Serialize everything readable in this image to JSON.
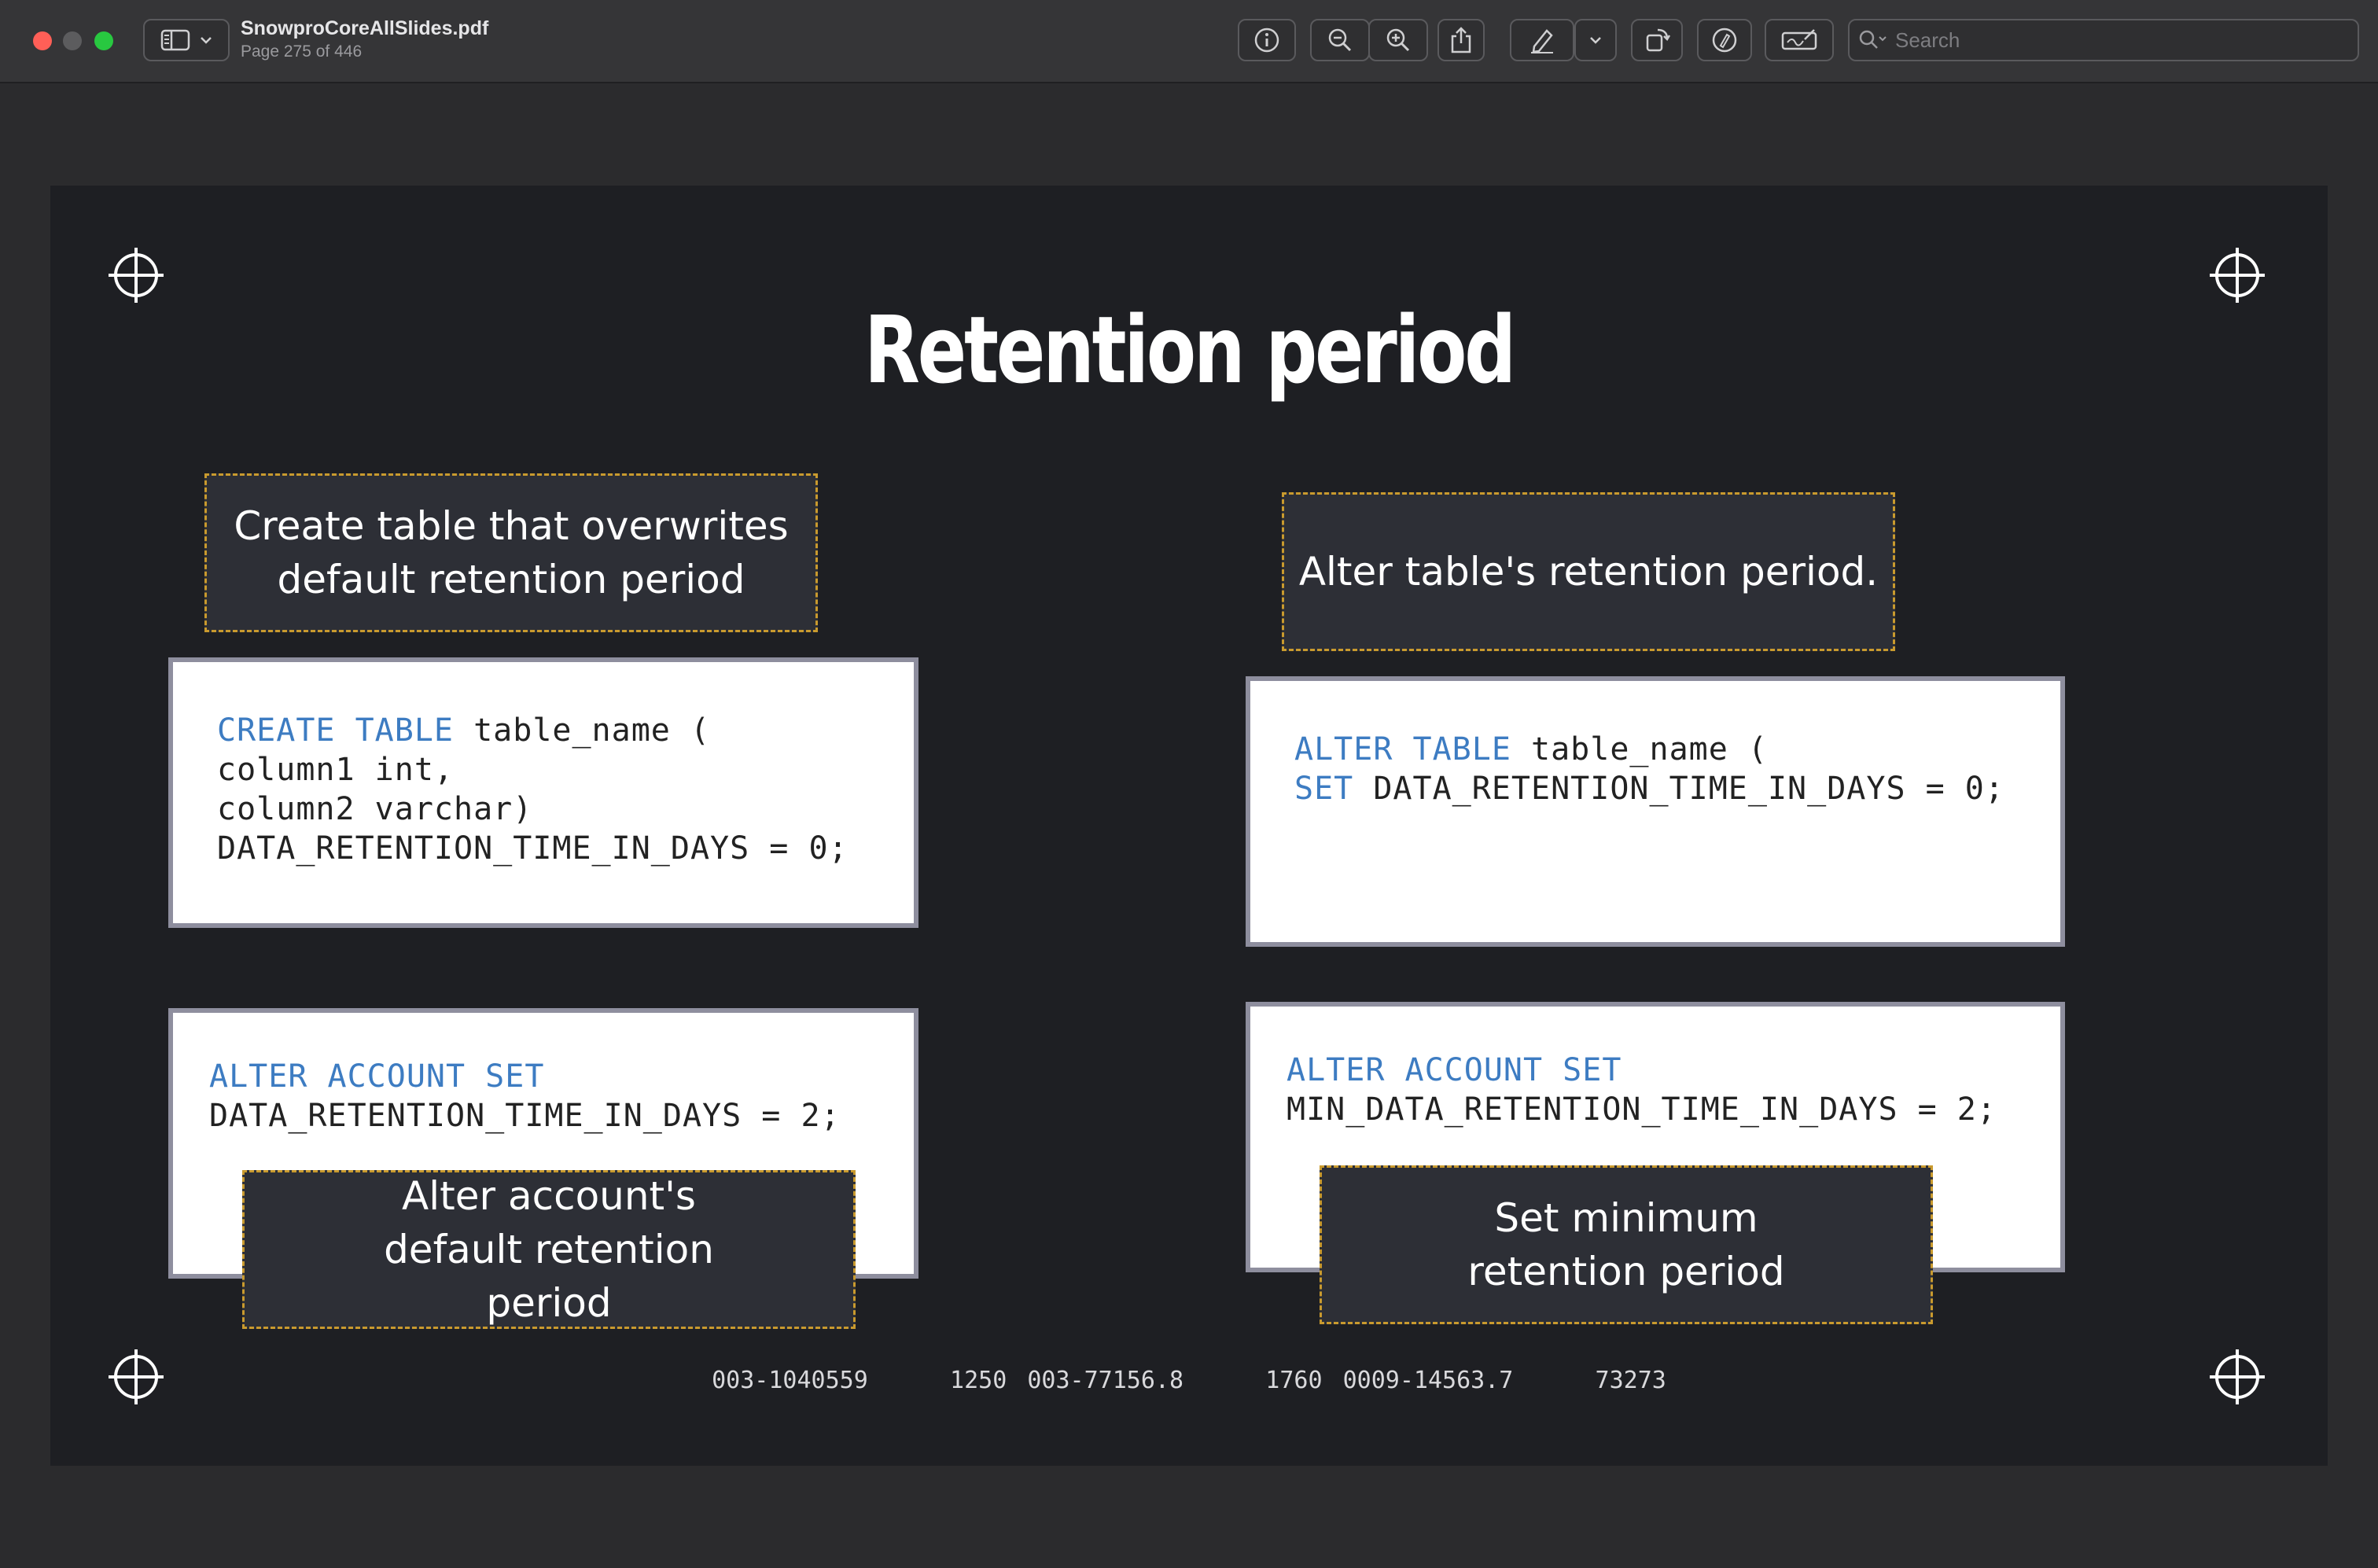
{
  "window": {
    "file_name": "SnowproCoreAllSlides.pdf",
    "page_status": "Page 275 of 446",
    "search_placeholder": "Search"
  },
  "toolbar": {
    "icons": [
      "sidebar-icon",
      "chevron-down-icon",
      "info-icon",
      "zoom-out-icon",
      "zoom-in-icon",
      "share-icon",
      "pen-icon",
      "chevron-down-icon",
      "rotate-icon",
      "markup-icon",
      "signature-icon",
      "search-icon"
    ]
  },
  "slide": {
    "title": "Retention period",
    "callout_create": "Create table that overwrites default retention period",
    "callout_alter_table": "Alter table's retention period.",
    "callout_alter_account": "Alter account's default retention period",
    "callout_min": "Set minimum retention period",
    "code_create": {
      "kw1": "CREATE TABLE",
      "l1": " table_name (",
      "l2": "column1 int,",
      "l3": "column2 varchar)",
      "l4": "DATA_RETENTION_TIME_IN_DAYS = 0;"
    },
    "code_alter_table": {
      "kw1": "ALTER TABLE",
      "l1": " table_name (",
      "kw2": "SET",
      "l2": " DATA_RETENTION_TIME_IN_DAYS = 0;"
    },
    "code_alter_account": {
      "kw1": "ALTER ACCOUNT SET",
      "l2": "DATA_RETENTION_TIME_IN_DAYS = 2;"
    },
    "code_min": {
      "kw1": "ALTER ACCOUNT SET",
      "l2": "MIN_DATA_RETENTION_TIME_IN_DAYS = 2;"
    },
    "footer_numbers": "003-1040559    1250 003-77156.8    1760 0009-14563.7    73273"
  },
  "colors": {
    "keyword": "#3d7cc2",
    "callout_border": "#c99a2e",
    "slide_bg": "#1e1f23"
  }
}
